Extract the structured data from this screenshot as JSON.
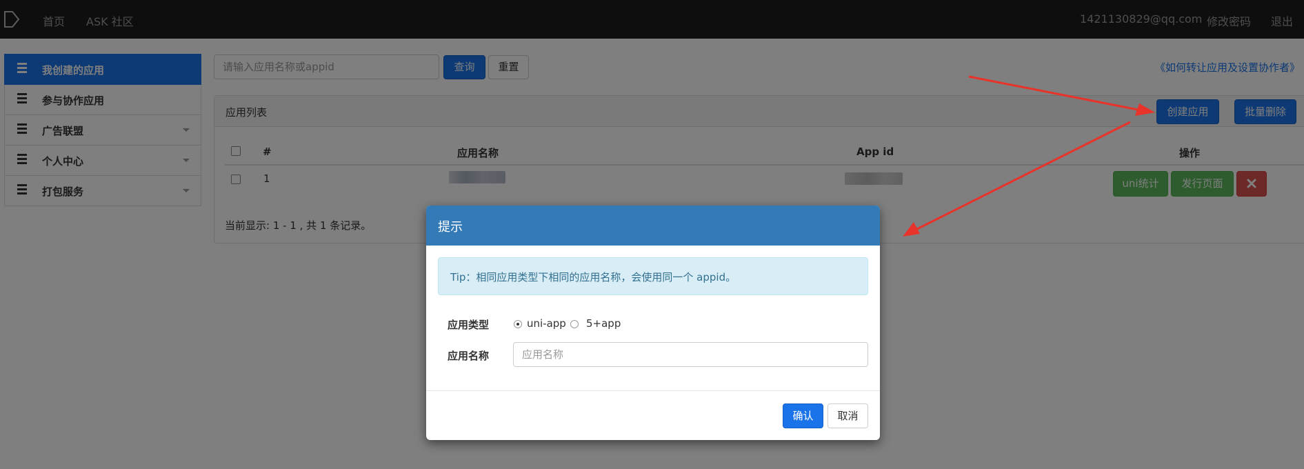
{
  "nav": {
    "home": "首页",
    "community": "ASK 社区",
    "user_email": "1421130829@qq.com",
    "change_password": "修改密码",
    "logout": "退出"
  },
  "sidebar": {
    "items": [
      {
        "label": "我创建的应用",
        "active": true,
        "has_caret": false
      },
      {
        "label": "参与协作应用",
        "active": false,
        "has_caret": false
      },
      {
        "label": "广告联盟",
        "active": false,
        "has_caret": true
      },
      {
        "label": "个人中心",
        "active": false,
        "has_caret": true
      },
      {
        "label": "打包服务",
        "active": false,
        "has_caret": true
      }
    ]
  },
  "search": {
    "placeholder": "请输入应用名称或appid",
    "query_label": "查询",
    "reset_label": "重置"
  },
  "help_link": "《如何转让应用及设置协作者》",
  "panel": {
    "title": "应用列表",
    "create_label": "创建应用",
    "batch_delete_label": "批量删除"
  },
  "table": {
    "columns": [
      "#",
      "应用名称",
      "App id",
      "操作"
    ],
    "rows": [
      {
        "index": "1",
        "actions": [
          "uni统计",
          "发行页面"
        ],
        "delete_icon": "close-x-icon"
      }
    ],
    "footer": "当前显示: 1 - 1 , 共 1 条记录。"
  },
  "modal": {
    "title": "提示",
    "tip": "Tip：相同应用类型下相同的应用名称，会使用同一个 appid。",
    "type_label": "应用类型",
    "type_options": [
      "uni-app",
      "5+app"
    ],
    "type_selected": "uni-app",
    "name_label": "应用名称",
    "name_placeholder": "应用名称",
    "confirm_label": "确认",
    "cancel_label": "取消"
  },
  "colors": {
    "primary": "#1a73e8",
    "modal_header": "#337ab7",
    "success": "#5cb85c",
    "danger": "#d9534f",
    "arrow": "#e8332a"
  }
}
